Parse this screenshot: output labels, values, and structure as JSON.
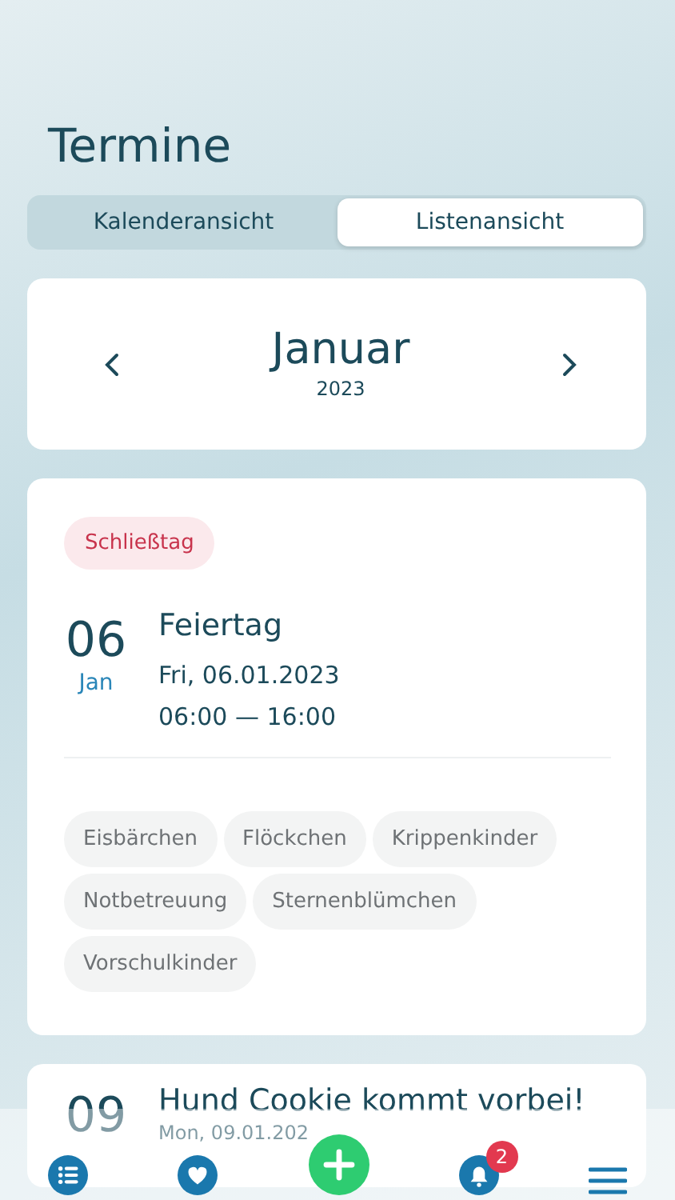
{
  "title": "Termine",
  "tabs": [
    {
      "label": "Kalenderansicht",
      "selected": false
    },
    {
      "label": "Listenansicht",
      "selected": true
    }
  ],
  "month": {
    "name": "Januar",
    "year": "2023"
  },
  "events": [
    {
      "tag": "Schließtag",
      "day": "06",
      "month": "Jan",
      "title": "Feiertag",
      "date": "Fri, 06.01.2023",
      "time": "06:00 — 16:00",
      "groups": [
        "Eisbärchen",
        "Flöckchen",
        "Krippenkinder",
        "Notbetreuung",
        "Sternenblümchen",
        "Vorschulkinder"
      ]
    },
    {
      "day": "09",
      "title": "Hund Cookie kommt vorbei!",
      "date": "Mon, 09.01.202"
    }
  ],
  "nav": {
    "badge": "2"
  }
}
